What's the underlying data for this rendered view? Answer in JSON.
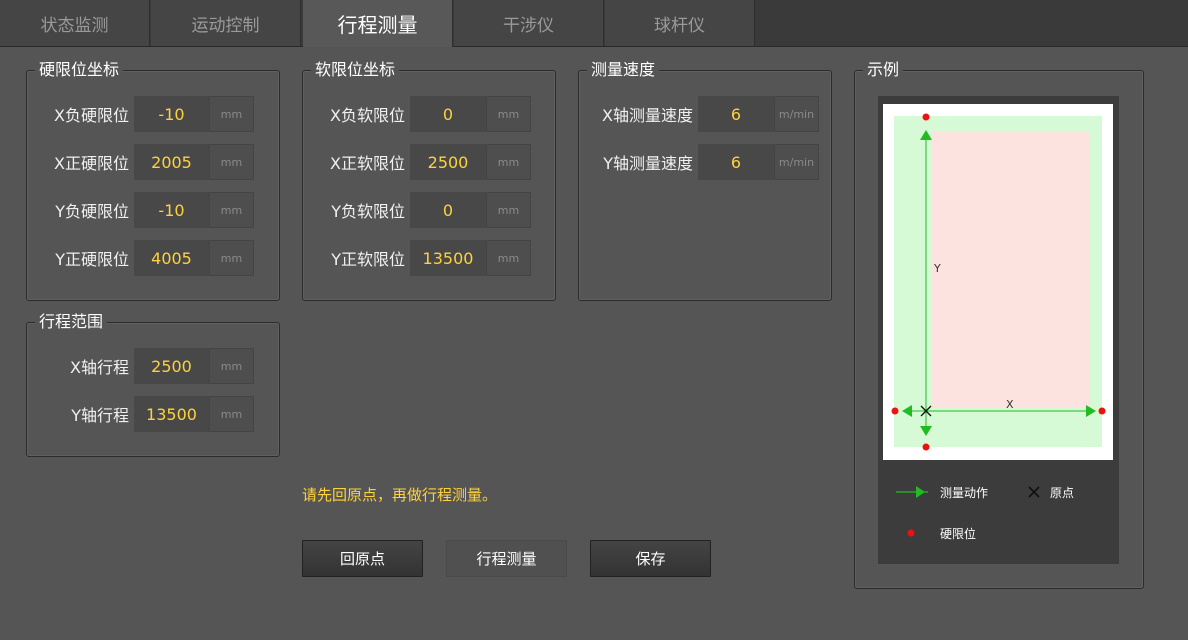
{
  "tabs": [
    {
      "label": "状态监测"
    },
    {
      "label": "运动控制"
    },
    {
      "label": "行程测量"
    },
    {
      "label": "干涉仪"
    },
    {
      "label": "球杆仪"
    }
  ],
  "hard_limits": {
    "title": "硬限位坐标",
    "rows": [
      {
        "label": "X负硬限位",
        "value": "-10",
        "unit": "mm"
      },
      {
        "label": "X正硬限位",
        "value": "2005",
        "unit": "mm"
      },
      {
        "label": "Y负硬限位",
        "value": "-10",
        "unit": "mm"
      },
      {
        "label": "Y正硬限位",
        "value": "4005",
        "unit": "mm"
      }
    ]
  },
  "soft_limits": {
    "title": "软限位坐标",
    "rows": [
      {
        "label": "X负软限位",
        "value": "0",
        "unit": "mm"
      },
      {
        "label": "X正软限位",
        "value": "2500",
        "unit": "mm"
      },
      {
        "label": "Y负软限位",
        "value": "0",
        "unit": "mm"
      },
      {
        "label": "Y正软限位",
        "value": "13500",
        "unit": "mm"
      }
    ]
  },
  "speed": {
    "title": "测量速度",
    "rows": [
      {
        "label": "X轴测量速度",
        "value": "6",
        "unit": "m/min"
      },
      {
        "label": "Y轴测量速度",
        "value": "6",
        "unit": "m/min"
      }
    ]
  },
  "travel": {
    "title": "行程范围",
    "rows": [
      {
        "label": "X轴行程",
        "value": "2500",
        "unit": "mm"
      },
      {
        "label": "Y轴行程",
        "value": "13500",
        "unit": "mm"
      }
    ]
  },
  "example": {
    "title": "示例",
    "y_axis": "Y",
    "x_axis": "X",
    "legend_move": "测量动作",
    "legend_origin": "原点",
    "legend_limit": "硬限位"
  },
  "hint": "请先回原点，再做行程测量。",
  "buttons": {
    "home": "回原点",
    "measure": "行程测量",
    "save": "保存"
  },
  "colors": {
    "value": "#ffd23c",
    "green": "#22bb22",
    "limit": "#ee1111"
  }
}
